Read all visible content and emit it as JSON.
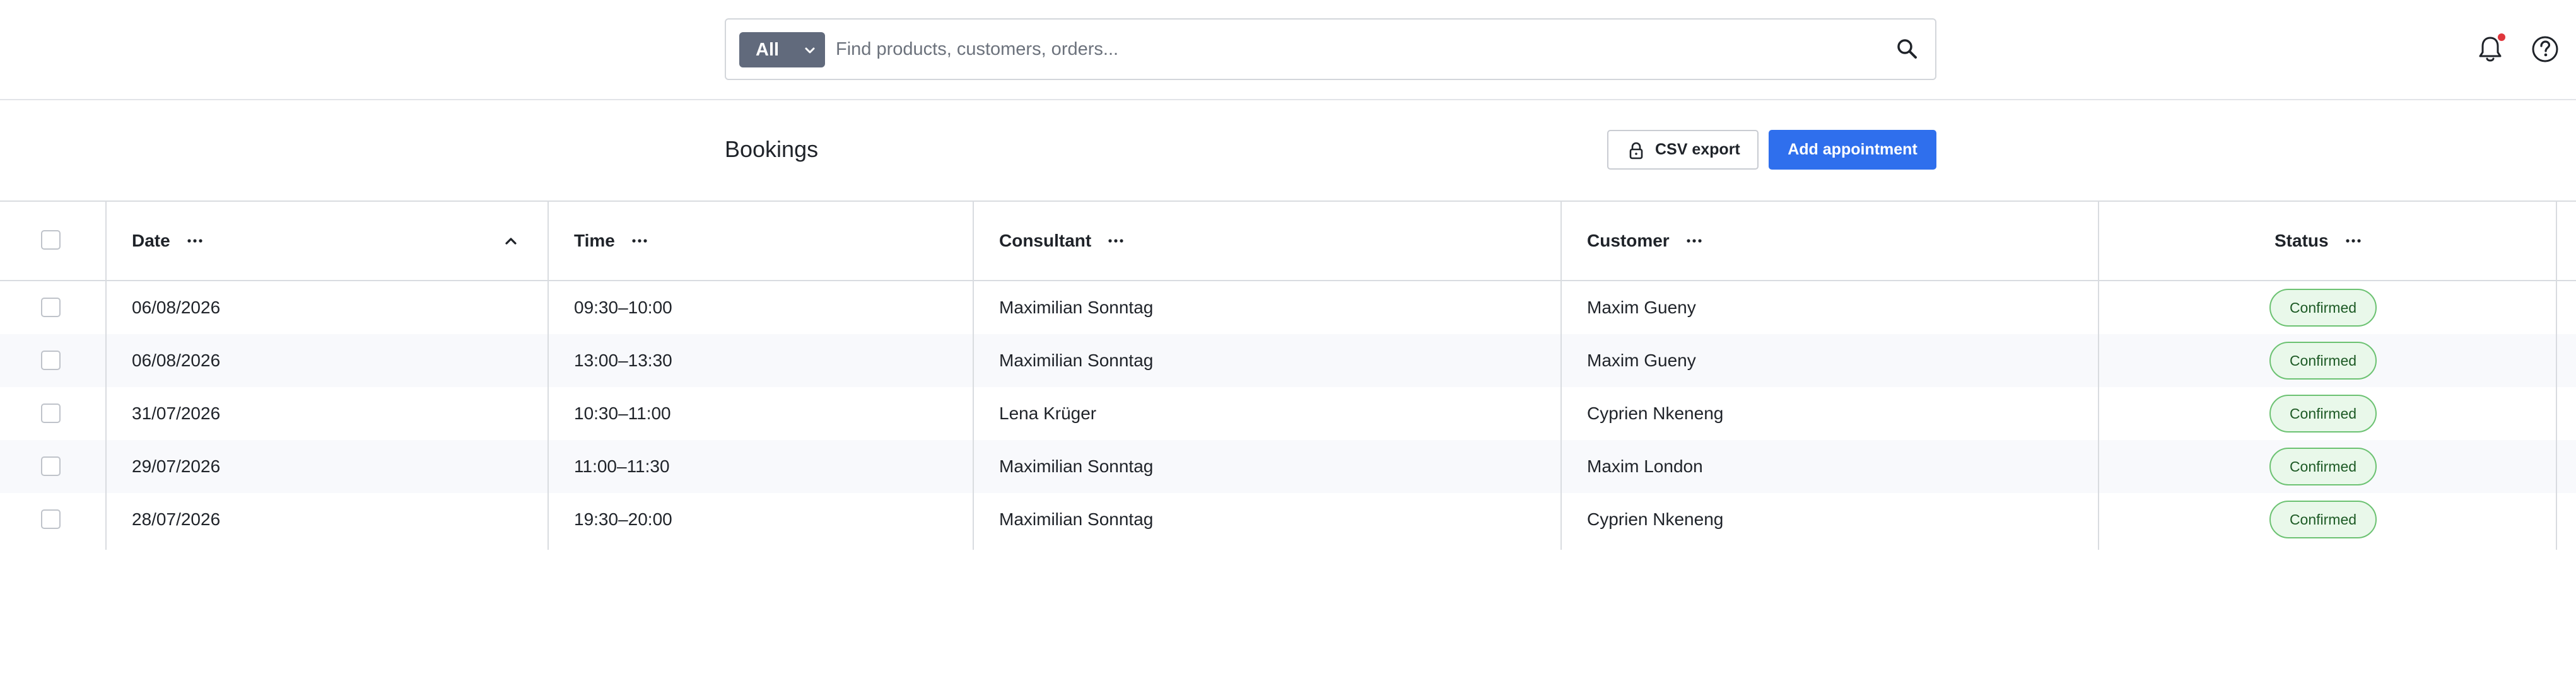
{
  "header": {
    "scope_label": "All",
    "search_placeholder": "Find products, customers, orders...",
    "search_value": ""
  },
  "page": {
    "title": "Bookings",
    "csv_export_label": "CSV export",
    "add_label": "Add appointment"
  },
  "table": {
    "columns": [
      "Date",
      "Time",
      "Consultant",
      "Customer",
      "Status"
    ],
    "rows": [
      [
        "06/08/2026",
        "09:30–10:00",
        "Maximilian Sonntag",
        "Maxim Gueny",
        "Confirmed"
      ],
      [
        "06/08/2026",
        "13:00–13:30",
        "Maximilian Sonntag",
        "Maxim Gueny",
        "Confirmed"
      ],
      [
        "31/07/2026",
        "10:30–11:00",
        "Lena Krüger",
        "Cyprien Nkeneng",
        "Confirmed"
      ],
      [
        "29/07/2026",
        "11:00–11:30",
        "Maximilian Sonntag",
        "Maxim London",
        "Confirmed"
      ],
      [
        "28/07/2026",
        "19:30–20:00",
        "Maximilian Sonntag",
        "Cyprien Nkeneng",
        "Confirmed"
      ]
    ]
  },
  "colors": {
    "accent": "#2f6fed",
    "scope_button": "#616a7c",
    "status_confirmed_bg": "#e9f8ea",
    "status_confirmed_border": "#6cc272",
    "notification_dot": "#e0363c"
  },
  "icons": {
    "scope_chevron": "chevron-down-icon",
    "search": "search-icon",
    "notifications": "bell-icon",
    "help": "help-icon",
    "export": "lock-icon",
    "column_menu": "more-horizontal-icon",
    "sort": "chevron-up-icon"
  }
}
